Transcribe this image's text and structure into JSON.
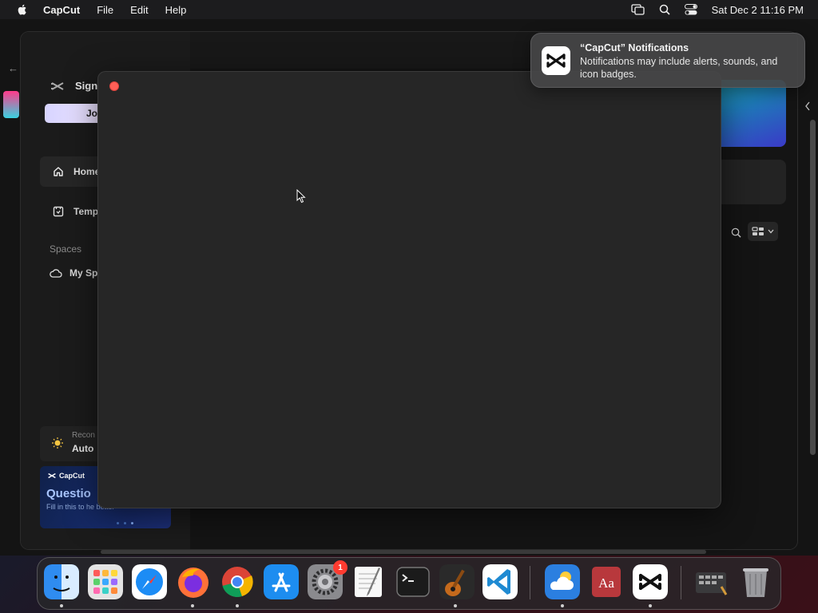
{
  "menubar": {
    "app_name": "CapCut",
    "items": [
      "File",
      "Edit",
      "Help"
    ],
    "datetime": "Sat Dec 2  11:16 PM"
  },
  "sidebar": {
    "sign_in_label": "Sign",
    "join_label": "Jo",
    "nav": [
      {
        "label": "Home",
        "icon": "home-icon"
      },
      {
        "label": "Temp",
        "icon": "template-icon"
      }
    ],
    "spaces_heading": "Spaces",
    "my_space_label": "My Sp",
    "recommend": {
      "small": "Recon",
      "big": "Auto"
    },
    "banner": {
      "brand": "CapCut",
      "headline": "Questio",
      "body": "Fill in this to he   better"
    }
  },
  "notification": {
    "title": "“CapCut” Notifications",
    "message": "Notifications may include alerts, sounds, and icon badges."
  },
  "dock": {
    "badge_count": "1",
    "apps": [
      "Finder",
      "Launchpad",
      "Safari",
      "Firefox",
      "Chrome",
      "App Store",
      "System Settings",
      "TextEdit",
      "Terminal",
      "GarageBand",
      "Visual Studio Code",
      "Weather",
      "Dictionary",
      "CapCut",
      "Downloads",
      "Trash"
    ]
  },
  "colors": {
    "modal_bg": "#262626",
    "close_red": "#ff5f57",
    "menubar_bg": "#1c1c1e"
  }
}
